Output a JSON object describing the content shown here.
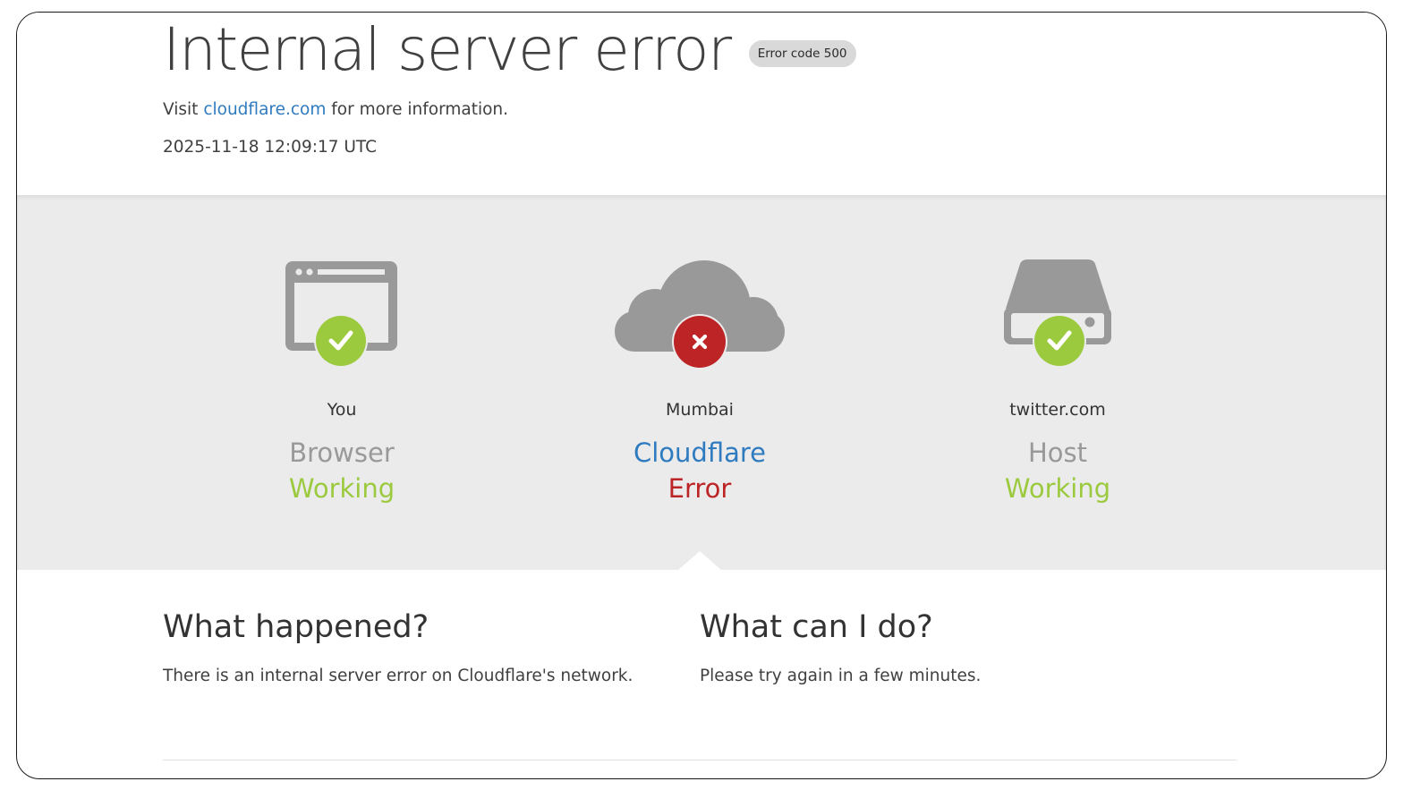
{
  "header": {
    "title": "Internal server error",
    "error_badge": "Error code 500",
    "visit_prefix": "Visit",
    "visit_link": "cloudflare.com",
    "visit_suffix": "for more information.",
    "timestamp": "2025-11-18 12:09:17 UTC"
  },
  "status": {
    "browser": {
      "location": "You",
      "role": "Browser",
      "state": "Working",
      "icon": "browser-icon",
      "badge_icon": "checkmark-icon"
    },
    "cloudflare": {
      "location": "Mumbai",
      "role": "Cloudflare",
      "state": "Error",
      "icon": "cloud-icon",
      "badge_icon": "x-icon"
    },
    "host": {
      "location": "twitter.com",
      "role": "Host",
      "state": "Working",
      "icon": "server-icon",
      "badge_icon": "checkmark-icon"
    }
  },
  "info": {
    "what_happened_title": "What happened?",
    "what_happened_body": "There is an internal server error on Cloudflare's network.",
    "what_can_i_do_title": "What can I do?",
    "what_can_i_do_body": "Please try again in a few minutes."
  },
  "colors": {
    "ok": "#9bca3e",
    "error": "#bd2426",
    "link": "#2f7bbf",
    "icon_gray": "#999999",
    "band": "#ebebeb"
  }
}
